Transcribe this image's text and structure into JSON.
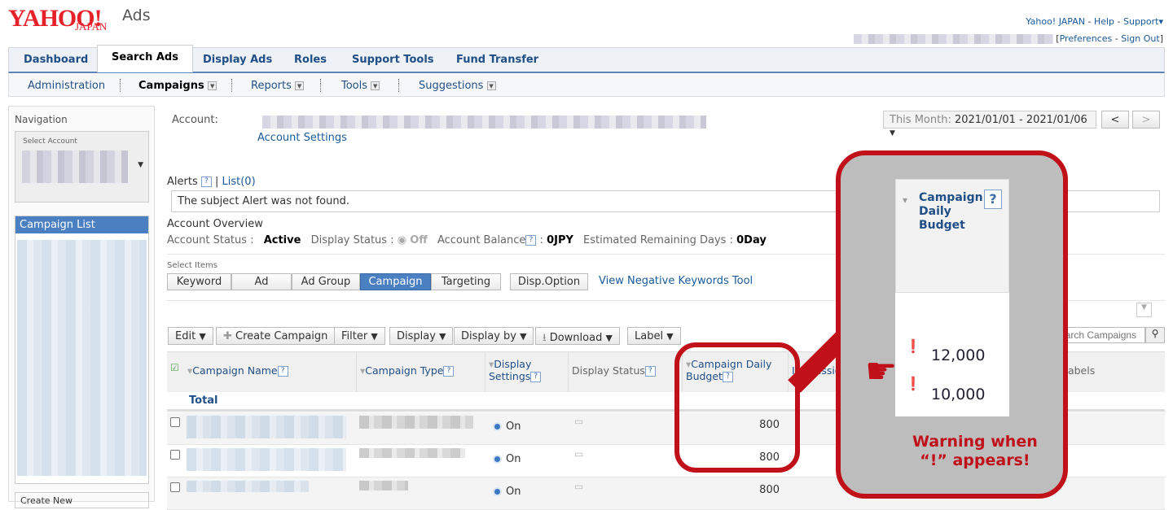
{
  "brand": {
    "logo": "YAHOO!",
    "logo_sub": "JAPAN",
    "product": "Ads"
  },
  "toplinks": {
    "yahoo": "Yahoo! JAPAN",
    "help": "Help",
    "support": "Support",
    "preferences": "Preferences",
    "signout": "Sign Out"
  },
  "tabs": [
    "Dashboard",
    "Search Ads",
    "Display Ads",
    "Roles",
    "Support Tools",
    "Fund Transfer"
  ],
  "subnav": [
    "Administration",
    "Campaigns",
    "Reports",
    "Tools",
    "Suggestions"
  ],
  "nav": {
    "title": "Navigation",
    "select_account": "Select Account",
    "campaign_list": "Campaign List",
    "create_new": "Create New"
  },
  "account": {
    "label": "Account:",
    "settings": "Account Settings"
  },
  "date": {
    "label": "This Month:",
    "range": "2021/01/01 - 2021/01/06",
    "prev": "<",
    "next": ">"
  },
  "alerts": {
    "label": "Alerts",
    "list": "List(0)",
    "message": "The subject Alert was not found."
  },
  "overview": {
    "title": "Account Overview",
    "status_label": "Account Status :",
    "status": "Active",
    "display_label": "Display Status :",
    "display": "Off",
    "balance_label": "Account Balance",
    "balance": "0JPY",
    "days_label": "Estimated Remaining Days :",
    "days": "0Day"
  },
  "select_items": {
    "label": "Select Items",
    "items": [
      "Keyword",
      "Ad",
      "Ad Group",
      "Campaign",
      "Targeting"
    ],
    "active": "Campaign",
    "disp_option": "Disp.Option",
    "negative_link": "View Negative Keywords Tool"
  },
  "toolbar": {
    "edit": "Edit",
    "create": "Create Campaign",
    "filter": "Filter",
    "display": "Display",
    "display_by": "Display by",
    "download": "Download",
    "label": "Label",
    "search_placeholder": "Search Campaigns"
  },
  "table": {
    "headers": [
      "Campaign Name",
      "Campaign Type",
      "Display Settings",
      "Display Status",
      "Campaign Daily Budget",
      "Impressions",
      "Labels"
    ],
    "total": "Total",
    "rows": [
      {
        "display": "On",
        "budget": "800"
      },
      {
        "display": "On",
        "budget": "800"
      },
      {
        "display": "On",
        "budget": "800"
      }
    ]
  },
  "callout": {
    "header": "Campaign Daily Budget",
    "values": [
      "12,000",
      "10,000"
    ],
    "warning_line1": "Warning when",
    "warning_line2": "“!” appears!"
  },
  "colors": {
    "accent": "#1f4f86",
    "annotation": "#c0111a",
    "active_segment": "#4a7fc1"
  }
}
